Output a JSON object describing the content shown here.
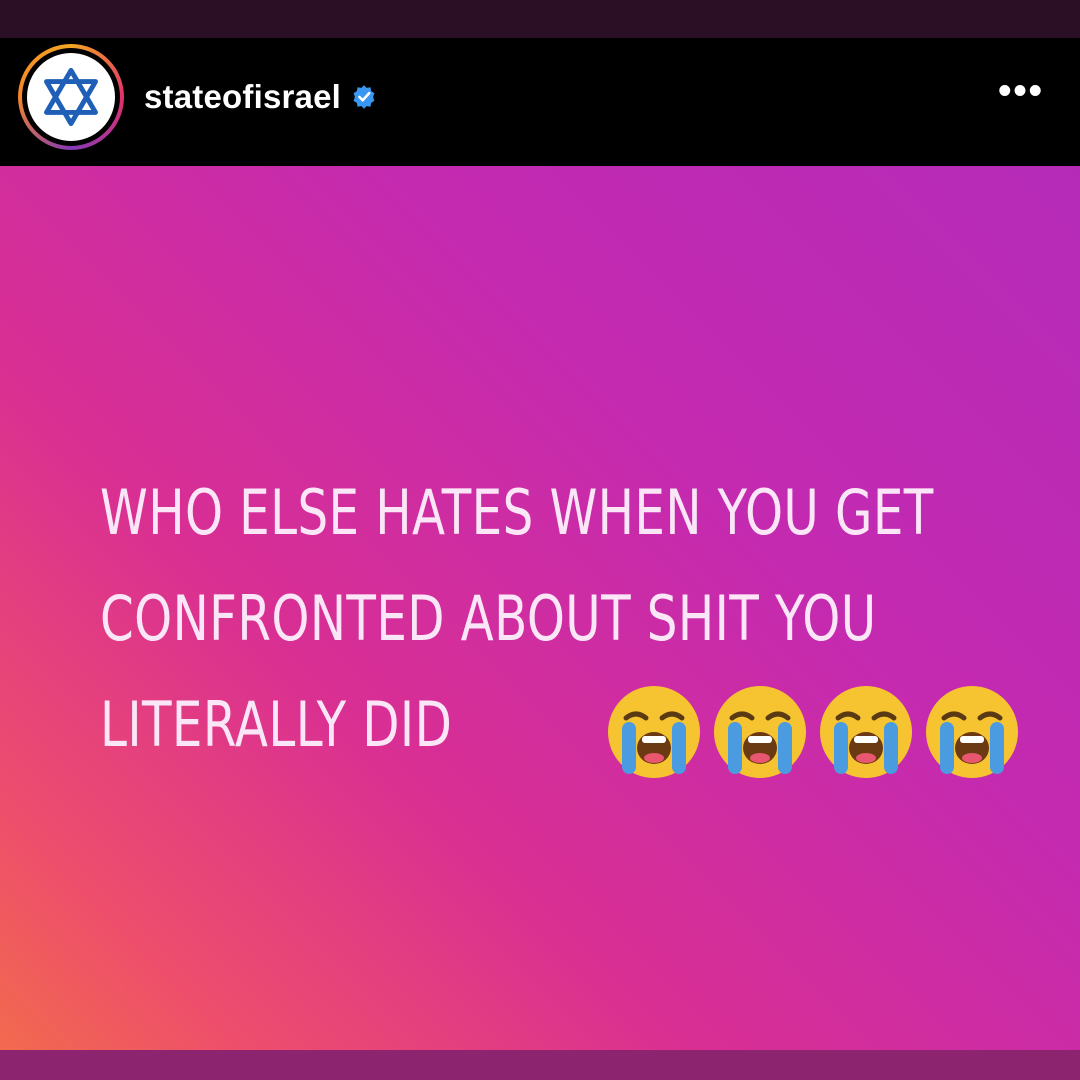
{
  "post": {
    "username": "stateofisrael",
    "more_label": "•••"
  },
  "story": {
    "lines": [
      "WHO ELSE HATES WHEN YOU GET",
      "CONFRONTED ABOUT SHIT YOU",
      "LITERALLY DID"
    ],
    "emoji": [
      "loudly-crying-face-icon",
      "loudly-crying-face-icon",
      "loudly-crying-face-icon",
      "loudly-crying-face-icon"
    ]
  },
  "colors": {
    "header_bg": "#000000",
    "verified_blue": "#3897f0",
    "star_blue": "#1f5fb8",
    "text": "#fbe6f7"
  }
}
